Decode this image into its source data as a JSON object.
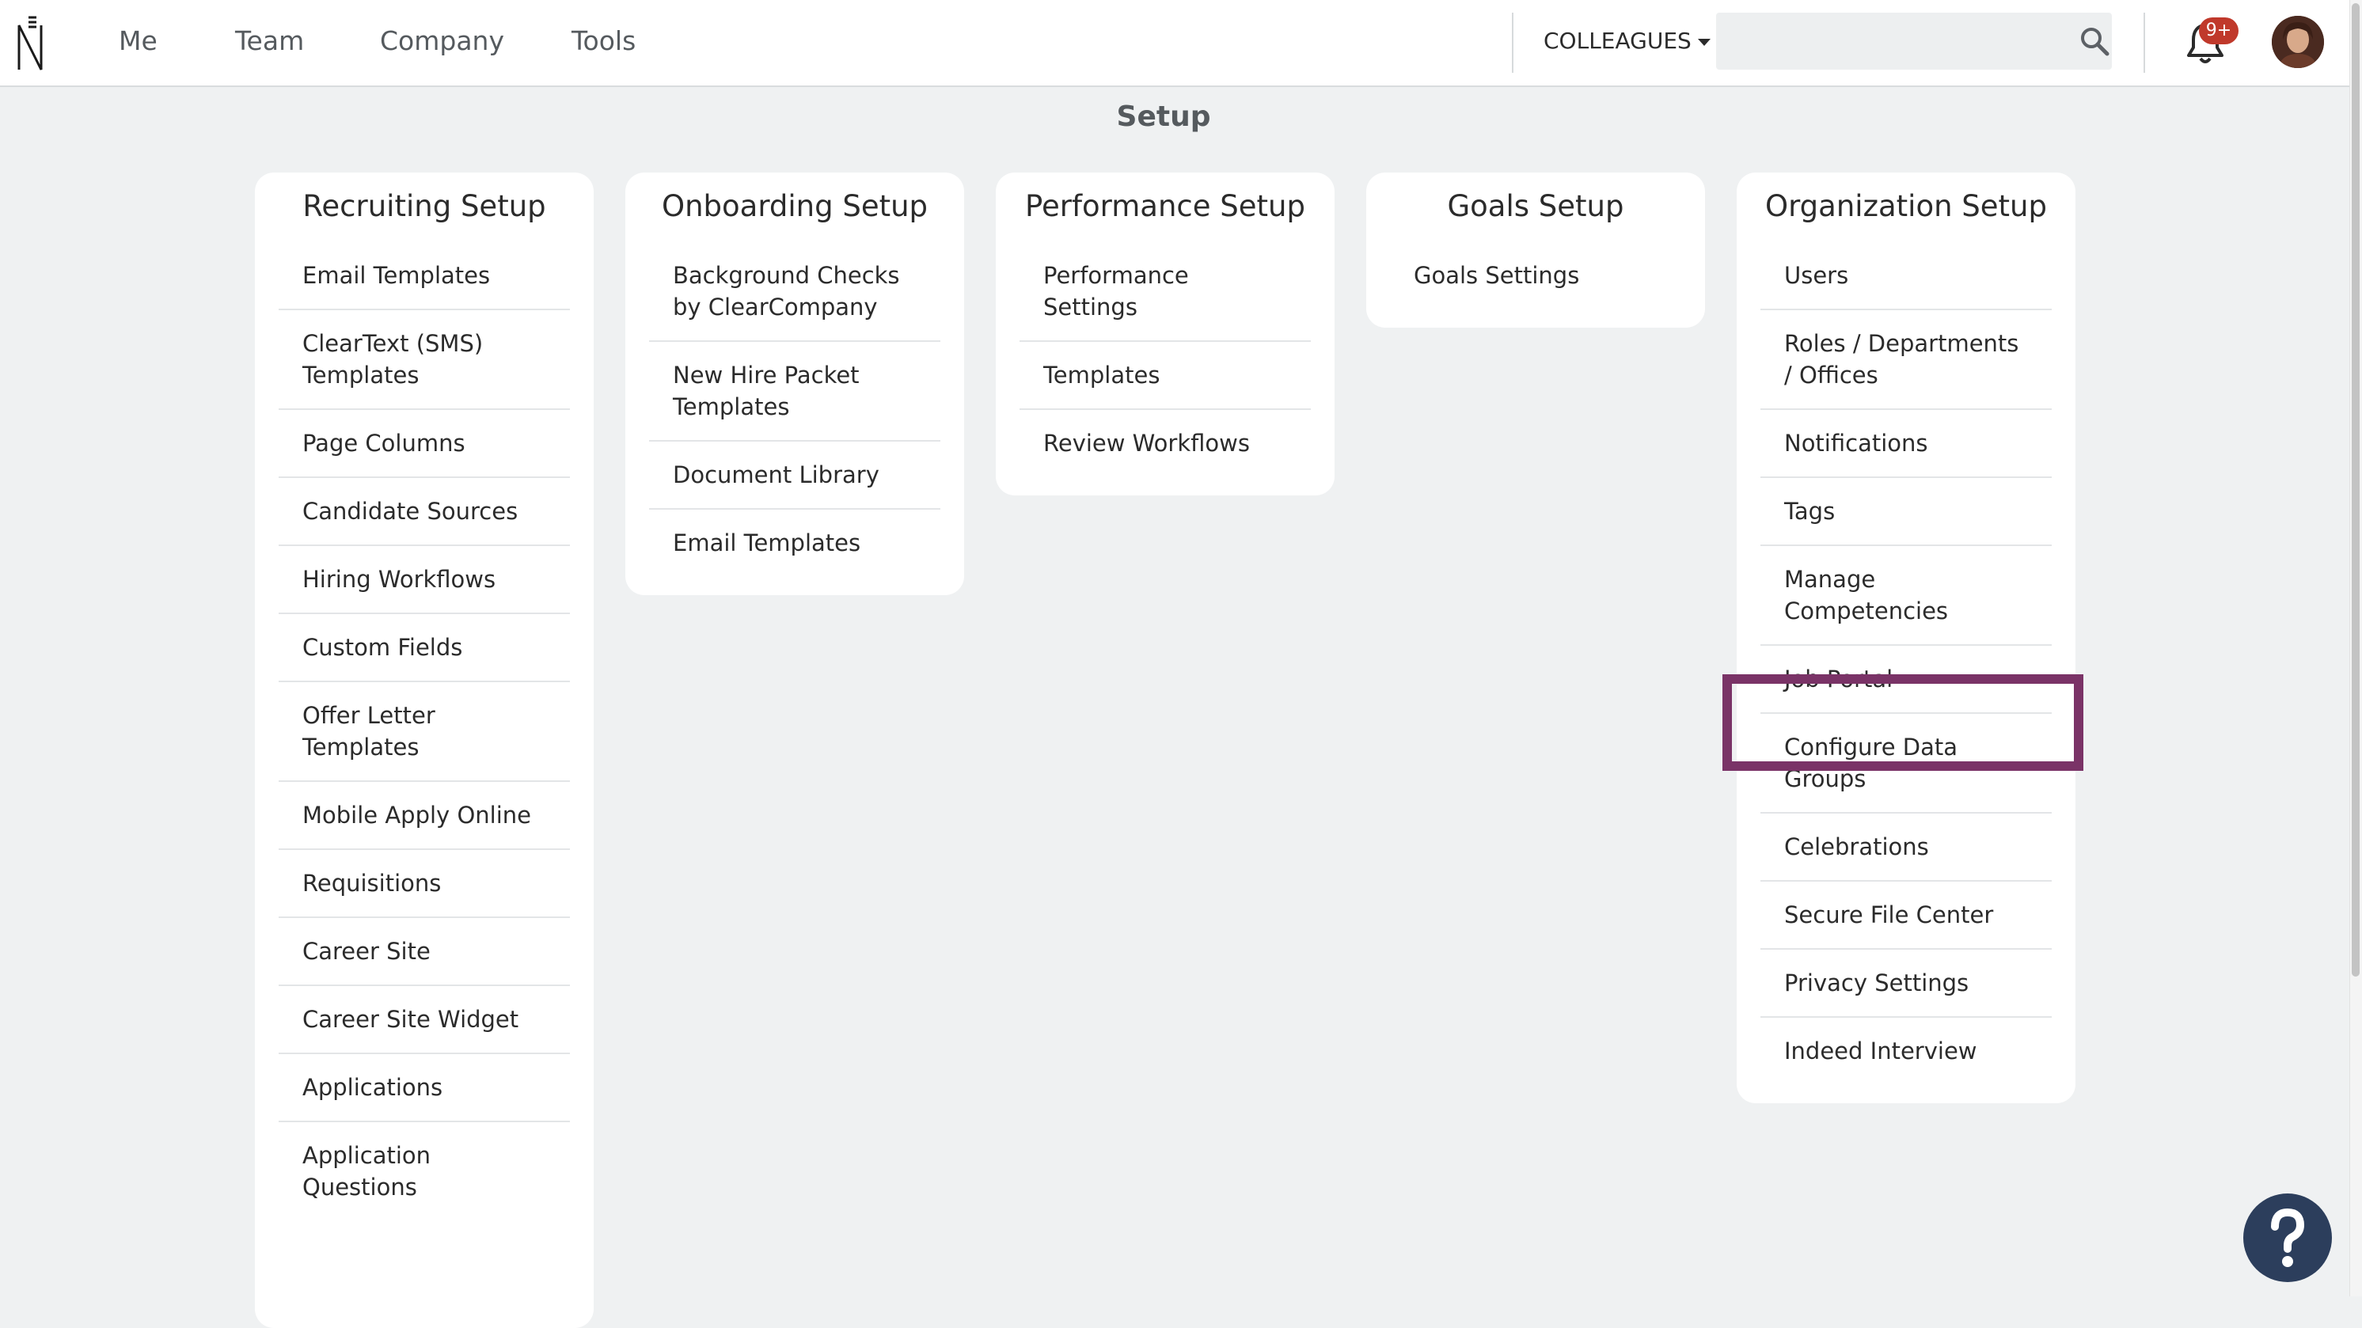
{
  "topbar": {
    "nav": [
      "Me",
      "Team",
      "Company",
      "Tools"
    ],
    "colleagues_label": "COLLEAGUES",
    "search": {
      "value": "",
      "placeholder": ""
    },
    "notification_count": "9+",
    "icons": {
      "logo": "logo-icon",
      "search": "search-icon",
      "bell": "bell-icon",
      "avatar": "user-avatar"
    }
  },
  "page": {
    "title": "Setup"
  },
  "cards": [
    {
      "title": "Recruiting Setup",
      "items": [
        "Email Templates",
        "ClearText (SMS) Templates",
        "Page Columns",
        "Candidate Sources",
        "Hiring Workflows",
        "Custom Fields",
        "Offer Letter Templates",
        "Mobile Apply Online",
        "Requisitions",
        "Career Site",
        "Career Site Widget",
        "Applications",
        "Application Questions"
      ]
    },
    {
      "title": "Onboarding Setup",
      "items": [
        "Background Checks by ClearCompany",
        "New Hire Packet Templates",
        "Document Library",
        "Email Templates"
      ]
    },
    {
      "title": "Performance Setup",
      "items": [
        "Performance Settings",
        "Templates",
        "Review Workflows"
      ]
    },
    {
      "title": "Goals Setup",
      "items": [
        "Goals Settings"
      ]
    },
    {
      "title": "Organization Setup",
      "items": [
        "Users",
        "Roles / Departments / Offices",
        "Notifications",
        "Tags",
        "Manage Competencies",
        "Job Portal",
        "Configure Data Groups",
        "Celebrations",
        "Secure File Center",
        "Privacy Settings",
        "Indeed Interview"
      ]
    }
  ],
  "highlighted_item": "Job Portal",
  "help": {
    "icon": "question-icon",
    "label": "?"
  },
  "colors": {
    "accent_highlight": "#7a3367",
    "help_button": "#2c3e5c",
    "badge": "#c0392b",
    "background": "#eff1f2"
  }
}
